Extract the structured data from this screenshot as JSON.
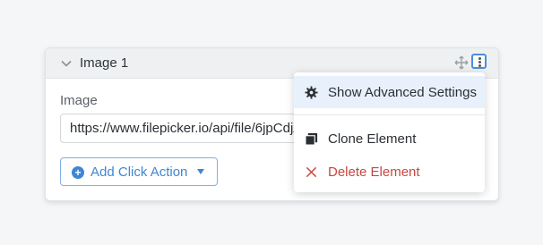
{
  "element": {
    "title": "Image 1"
  },
  "field": {
    "label": "Image",
    "value": "https://www.filepicker.io/api/file/6jpCdjAAA"
  },
  "actions": {
    "add_click_action": "Add Click Action"
  },
  "menu": {
    "items": [
      {
        "label": "Show Advanced Settings",
        "icon": "gear-icon"
      },
      {
        "label": "Clone Element",
        "icon": "clone-icon"
      },
      {
        "label": "Delete Element",
        "icon": "close-icon"
      }
    ]
  },
  "colors": {
    "accent": "#3f86d4",
    "danger": "#c7473f",
    "highlight": "#e8f1fb"
  }
}
